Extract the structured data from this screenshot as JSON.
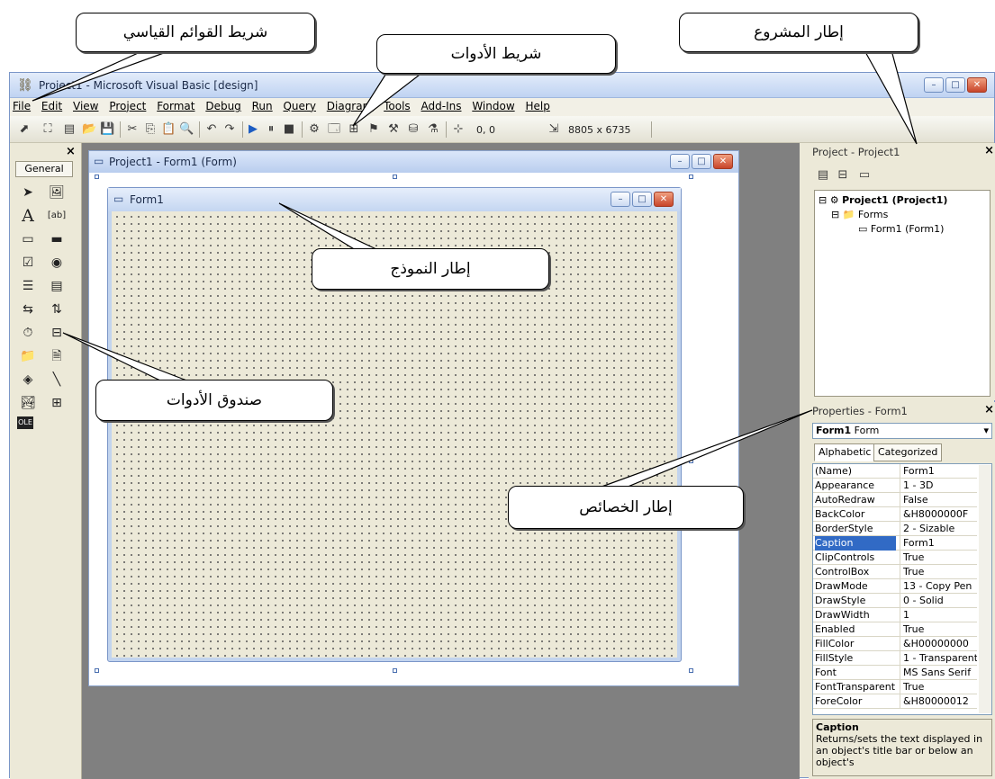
{
  "window": {
    "title": "Project1 - Microsoft Visual Basic [design]",
    "buttons": [
      "–",
      "□",
      "✕"
    ]
  },
  "menu": [
    "File",
    "Edit",
    "View",
    "Project",
    "Format",
    "Debug",
    "Run",
    "Query",
    "Diagram",
    "Tools",
    "Add-Ins",
    "Window",
    "Help"
  ],
  "toolbar": {
    "position": "0, 0",
    "size": "8805 x 6735"
  },
  "toolbox": {
    "close": "×",
    "tab": "General",
    "tools": [
      "pointer-icon",
      "picturebox-icon",
      "label-icon",
      "textbox-icon",
      "frame-icon",
      "commandbutton-icon",
      "checkbox-icon",
      "optionbutton-icon",
      "combobox-icon",
      "listbox-icon",
      "hscrollbar-icon",
      "vscrollbar-icon",
      "timer-icon",
      "drivelistbox-icon",
      "dirlistbox-icon",
      "filelistbox-icon",
      "shape-icon",
      "line-icon",
      "image-icon",
      "data-icon",
      "ole-icon"
    ]
  },
  "form_designer": {
    "title": "Project1 - Form1 (Form)",
    "form_caption": "Form1"
  },
  "project_panel": {
    "title": "Project - Project1",
    "close": "×",
    "tree": {
      "root": "Project1 (Project1)",
      "folder": "Forms",
      "item": "Form1 (Form1)"
    }
  },
  "properties_panel": {
    "title": "Properties - Form1",
    "close": "×",
    "object_bold": "Form1",
    "object_type": "Form",
    "tabs": [
      "Alphabetic",
      "Categorized"
    ],
    "rows": [
      {
        "name": "(Name)",
        "value": "Form1"
      },
      {
        "name": "Appearance",
        "value": "1 - 3D"
      },
      {
        "name": "AutoRedraw",
        "value": "False"
      },
      {
        "name": "BackColor",
        "value": "&H8000000F"
      },
      {
        "name": "BorderStyle",
        "value": "2 - Sizable"
      },
      {
        "name": "Caption",
        "value": "Form1"
      },
      {
        "name": "ClipControls",
        "value": "True"
      },
      {
        "name": "ControlBox",
        "value": "True"
      },
      {
        "name": "DrawMode",
        "value": "13 - Copy Pen"
      },
      {
        "name": "DrawStyle",
        "value": "0 - Solid"
      },
      {
        "name": "DrawWidth",
        "value": "1"
      },
      {
        "name": "Enabled",
        "value": "True"
      },
      {
        "name": "FillColor",
        "value": "&H00000000"
      },
      {
        "name": "FillStyle",
        "value": "1 - Transparent"
      },
      {
        "name": "Font",
        "value": "MS Sans Serif"
      },
      {
        "name": "FontTransparent",
        "value": "True"
      },
      {
        "name": "ForeColor",
        "value": "&H80000012"
      }
    ],
    "selected_row": "Caption",
    "desc_title": "Caption",
    "desc_text": "Returns/sets the text displayed in an object's title bar or below an object's"
  },
  "callouts": {
    "menu_bar": "شريط القوائم القياسي",
    "toolbar": "شريط الأدوات",
    "project": "إطار المشروع",
    "form": "إطار النموذج",
    "toolbox": "صندوق الأدوات",
    "properties": "إطار الخصائص"
  },
  "colors": {
    "accent": "#316ac5",
    "mdi_background": "#808080",
    "chrome": "#ece9d8"
  }
}
